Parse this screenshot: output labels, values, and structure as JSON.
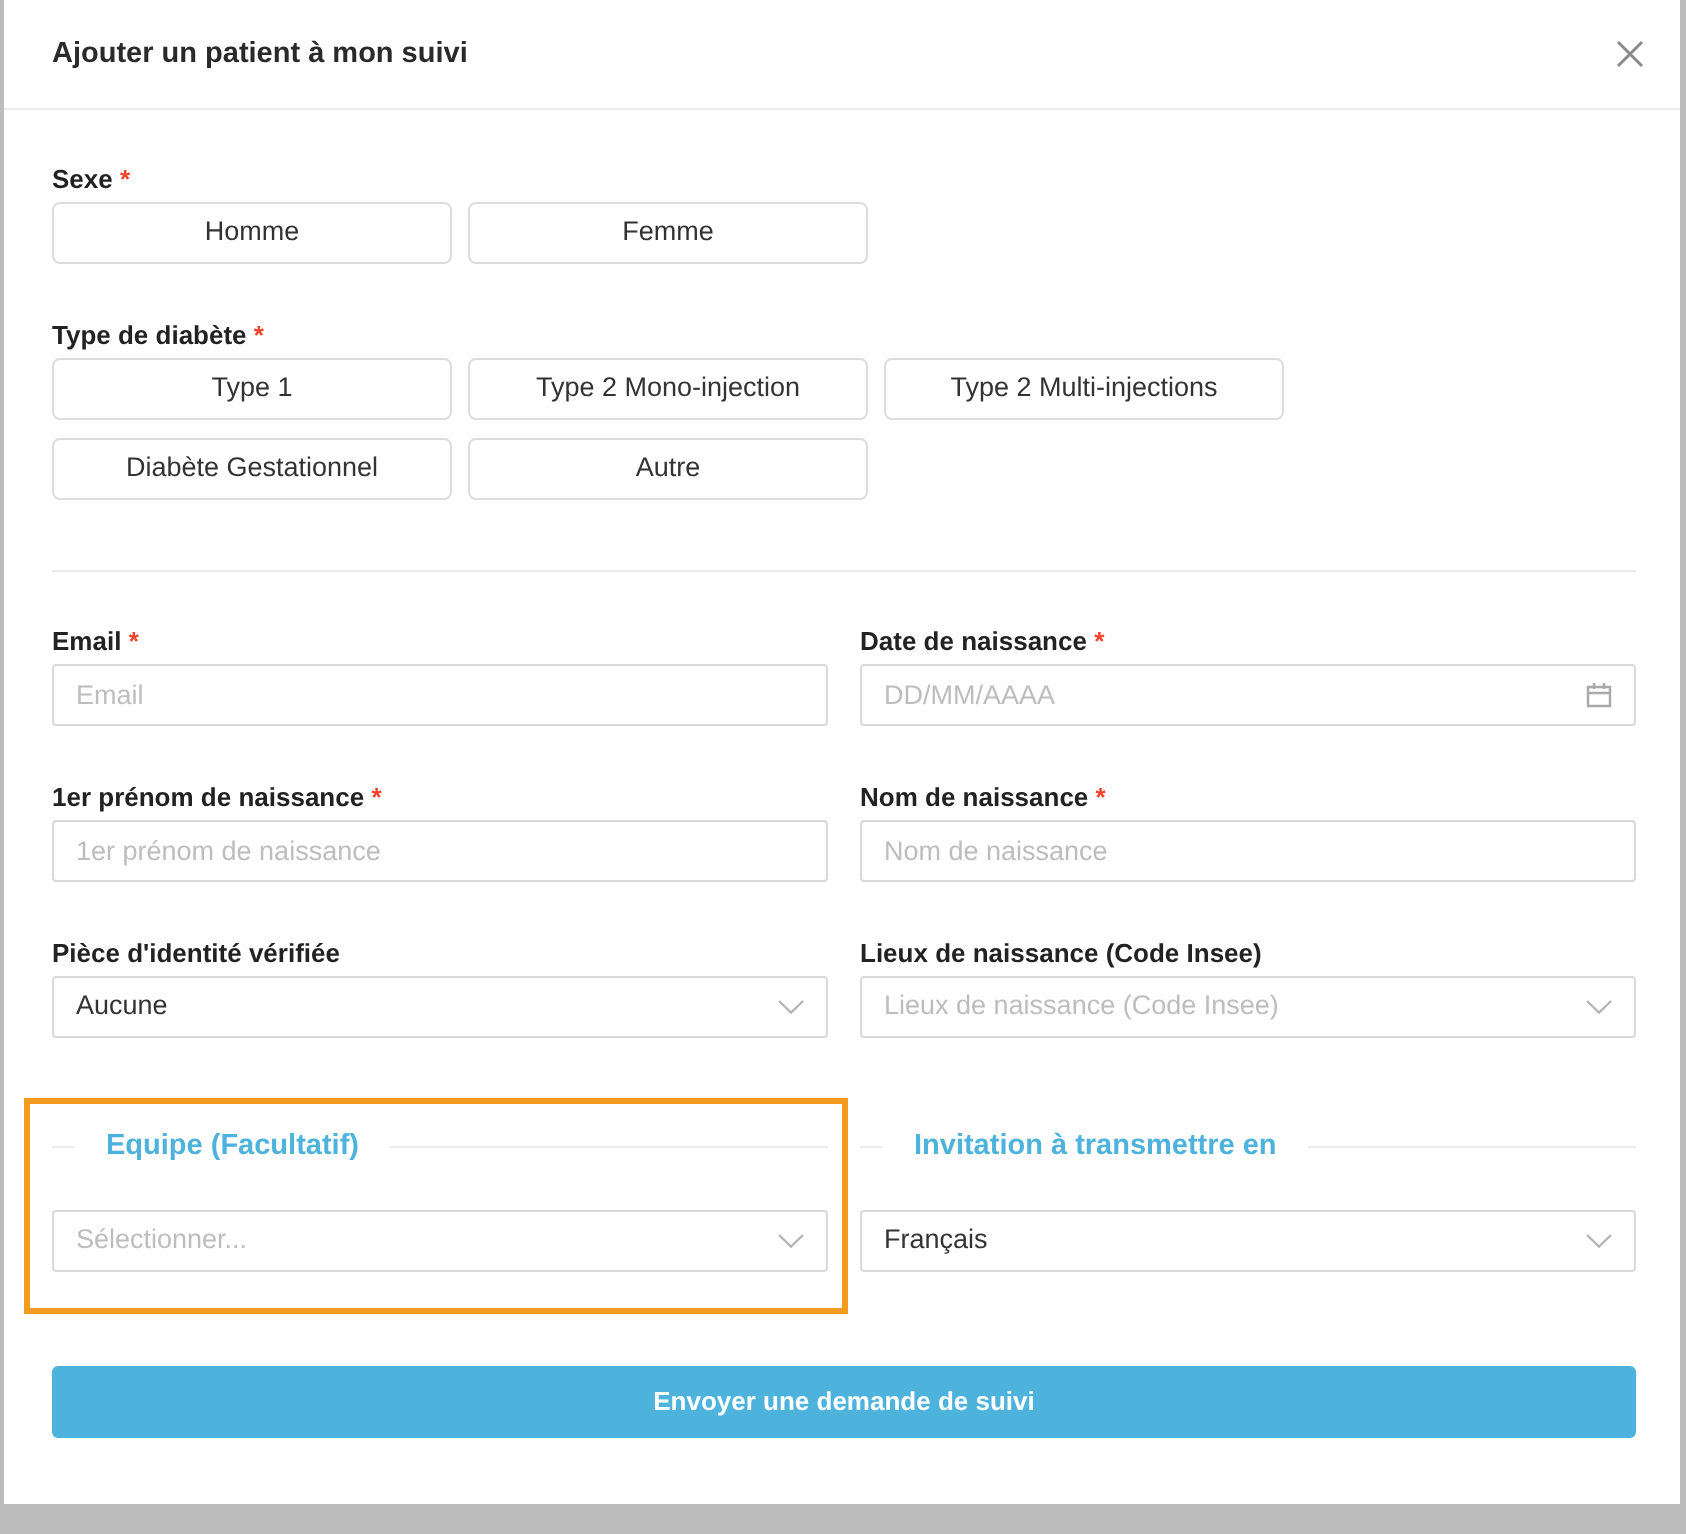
{
  "modal": {
    "title": "Ajouter un patient à mon suivi"
  },
  "choice_groups": [
    {
      "label": "Sexe",
      "required_mark": "*",
      "options": [
        {
          "label": "Homme",
          "selected": false
        },
        {
          "label": "Femme",
          "selected": false
        }
      ]
    },
    {
      "label": "Type de diabète",
      "required_mark": "*",
      "options": [
        {
          "label": "Type 1",
          "selected": false
        },
        {
          "label": "Type 2 Mono-injection",
          "selected": false
        },
        {
          "label": "Type 2 Multi-injections",
          "selected": false
        },
        {
          "label": "Diabète Gestationnel",
          "selected": false
        },
        {
          "label": "Autre",
          "selected": false
        }
      ]
    }
  ],
  "fields": [
    {
      "label": "Email",
      "required_mark": "*",
      "kind": "text",
      "placeholder": "Email"
    },
    {
      "label": "Date de naissance",
      "required_mark": "*",
      "kind": "date",
      "placeholder": "DD/MM/AAAA"
    },
    {
      "label": "1er prénom de naissance",
      "required_mark": "*",
      "kind": "text",
      "placeholder": "1er prénom de naissance"
    },
    {
      "label": "Nom de naissance",
      "required_mark": "*",
      "kind": "text",
      "placeholder": "Nom de naissance"
    },
    {
      "label": "Pièce d'identité vérifiée",
      "kind": "select",
      "value": "Aucune"
    },
    {
      "label": "Lieux de naissance (Code Insee)",
      "kind": "select",
      "placeholder": "Lieux de naissance (Code Insee)"
    }
  ],
  "sections": [
    {
      "title": "Equipe (Facultatif)",
      "highlighted": true,
      "field": {
        "kind": "select",
        "placeholder": "Sélectionner..."
      }
    },
    {
      "title": "Invitation à transmettre en",
      "highlighted": false,
      "field": {
        "kind": "select",
        "value": "Français"
      }
    }
  ],
  "submit": {
    "label": "Envoyer une demande de suivi"
  }
}
